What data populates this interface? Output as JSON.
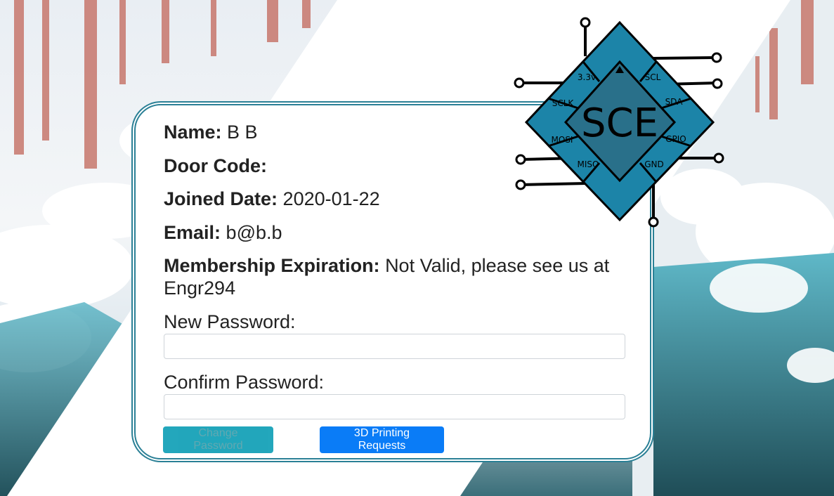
{
  "profile": {
    "name_label": "Name:",
    "name_value": "B B",
    "door_label": "Door Code:",
    "door_value": "",
    "joined_label": "Joined Date:",
    "joined_value": "2020-01-22",
    "email_label": "Email:",
    "email_value": "b@b.b",
    "membership_label": "Membership Expiration:",
    "membership_value_line1": "Not Valid, please see us at",
    "membership_value_line2": "Engr294"
  },
  "form": {
    "new_password_label": "New Password:",
    "new_password_value": "",
    "confirm_password_label": "Confirm Password:",
    "confirm_password_value": "",
    "change_button": "Change Password",
    "printing_button": "3D Printing Requests"
  },
  "logo": {
    "center_text": "SCE",
    "pins": [
      "3.3v",
      "SCL",
      "SCLK",
      "SDA",
      "MOSI",
      "GPIO",
      "MISO",
      "GND"
    ]
  },
  "colors": {
    "accent": "#2b8096",
    "logo_blue": "#1c84a8",
    "change_button_bg": "#17a2b8",
    "printing_button_bg": "#0a7cf7"
  }
}
